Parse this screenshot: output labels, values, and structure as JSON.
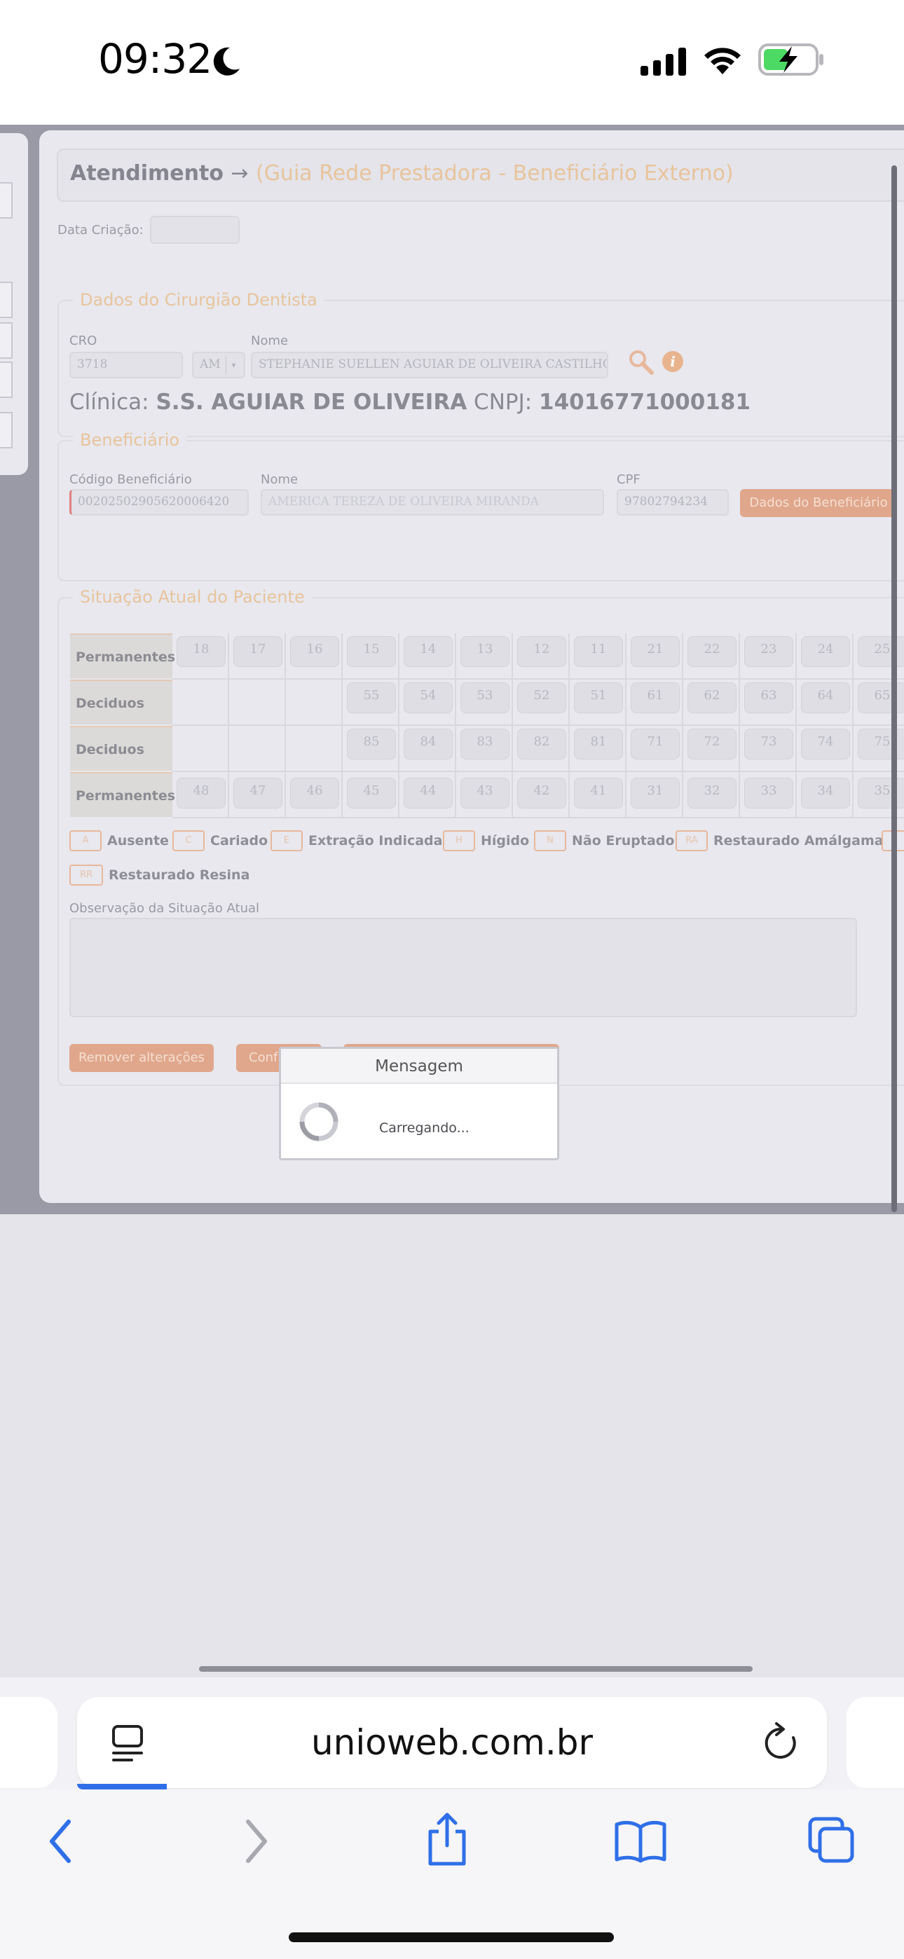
{
  "status_bar": {
    "time": "09:32"
  },
  "page": {
    "title": "Atendimento",
    "title_arrow": "→",
    "subtitle": "(Guia Rede Prestadora - Beneficiário Externo)",
    "data_criacao_label": "Data Criação:",
    "data_criacao_value": ""
  },
  "dentista": {
    "legend": "Dados do Cirurgião Dentista",
    "cro_label": "CRO",
    "cro_value": "3718",
    "uf_value": "AM",
    "nome_label": "Nome",
    "nome_value": "STEPHANIE SUELLEN AGUIAR DE OLIVEIRA CASTILHO",
    "clinica_label": "Clínica:",
    "clinica_value": "S.S. AGUIAR DE OLIVEIRA",
    "cnpj_label": "CNPJ:",
    "cnpj_value": "14016771000181"
  },
  "beneficiario": {
    "legend": "Beneficiário",
    "codigo_label": "Código Beneficiário",
    "codigo_value": "00202502905620006420",
    "nome_label": "Nome",
    "nome_value": "AMERICA TEREZA DE OLIVEIRA MIRANDA",
    "cpf_label": "CPF",
    "cpf_value": "97802794234",
    "dados_button": "Dados do Beneficiário"
  },
  "situacao": {
    "legend": "Situação Atual do Paciente",
    "rows": [
      {
        "label": "Permanentes",
        "teeth": [
          "18",
          "17",
          "16",
          "15",
          "14",
          "13",
          "12",
          "11",
          "21",
          "22",
          "23",
          "24",
          "25"
        ]
      },
      {
        "label": "Deciduos",
        "teeth": [
          "",
          "",
          "",
          "55",
          "54",
          "53",
          "52",
          "51",
          "61",
          "62",
          "63",
          "64",
          "65"
        ]
      },
      {
        "label": "Deciduos",
        "teeth": [
          "",
          "",
          "",
          "85",
          "84",
          "83",
          "82",
          "81",
          "71",
          "72",
          "73",
          "74",
          "75"
        ]
      },
      {
        "label": "Permanentes",
        "teeth": [
          "48",
          "47",
          "46",
          "45",
          "44",
          "43",
          "42",
          "41",
          "31",
          "32",
          "33",
          "34",
          "35"
        ]
      }
    ],
    "legend_items": [
      {
        "code": "A",
        "text": "Ausente"
      },
      {
        "code": "C",
        "text": "Cariado"
      },
      {
        "code": "E",
        "text": "Extração Indicada"
      },
      {
        "code": "H",
        "text": "Hígido"
      },
      {
        "code": "N",
        "text": "Não Eruptado"
      },
      {
        "code": "RA",
        "text": "Restaurado Amálgama"
      },
      {
        "code": "RR",
        "text": "Restaurado Resina"
      }
    ],
    "obs_label": "Observação da Situação Atual",
    "remove_button": "Remover alterações",
    "confirm_button": "Conf"
  },
  "modal": {
    "title": "Mensagem",
    "text": "Carregando..."
  },
  "browser": {
    "url": "unioweb.com.br"
  },
  "colors": {
    "accent": "#e0a78c",
    "link": "#2f6fe8",
    "overlay": "#999aa6"
  }
}
